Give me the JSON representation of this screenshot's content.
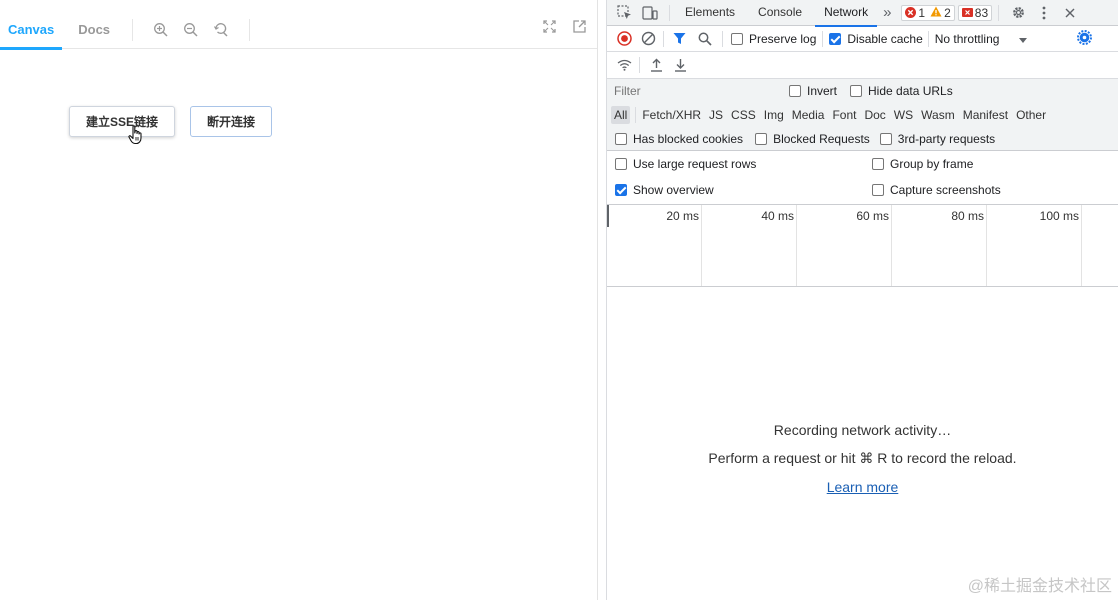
{
  "storybook": {
    "tabs": [
      "Canvas",
      "Docs"
    ],
    "buttons": {
      "connect": "建立SSE链接",
      "disconnect": "断开连接"
    }
  },
  "devtools": {
    "tabs": [
      "Elements",
      "Console",
      "Network"
    ],
    "more": "»",
    "badges": {
      "errors": "1",
      "warnings": "2",
      "issues": "83"
    },
    "toolbar": {
      "preserve_log": "Preserve log",
      "disable_cache": "Disable cache",
      "throttling": "No throttling"
    },
    "filter": {
      "placeholder": "Filter",
      "invert": "Invert",
      "hide_data_urls": "Hide data URLs"
    },
    "types": [
      "All",
      "Fetch/XHR",
      "JS",
      "CSS",
      "Img",
      "Media",
      "Font",
      "Doc",
      "WS",
      "Wasm",
      "Manifest",
      "Other"
    ],
    "blocked": {
      "has_blocked_cookies": "Has blocked cookies",
      "blocked_requests": "Blocked Requests",
      "third_party": "3rd-party requests"
    },
    "options": {
      "large_rows": "Use large request rows",
      "group_by_frame": "Group by frame",
      "show_overview": "Show overview",
      "capture_screenshots": "Capture screenshots"
    },
    "overview_ticks": [
      "20 ms",
      "40 ms",
      "60 ms",
      "80 ms",
      "100 ms"
    ],
    "empty": {
      "title": "Recording network activity…",
      "hint": "Perform a request or hit ⌘ R to record the reload.",
      "link": "Learn more"
    }
  },
  "watermark": "@稀土掘金技术社区",
  "colors": {
    "accent": "#1ea7fd",
    "devtools_blue": "#1a73e8",
    "record_red": "#d93025",
    "warning": "#f29900"
  }
}
